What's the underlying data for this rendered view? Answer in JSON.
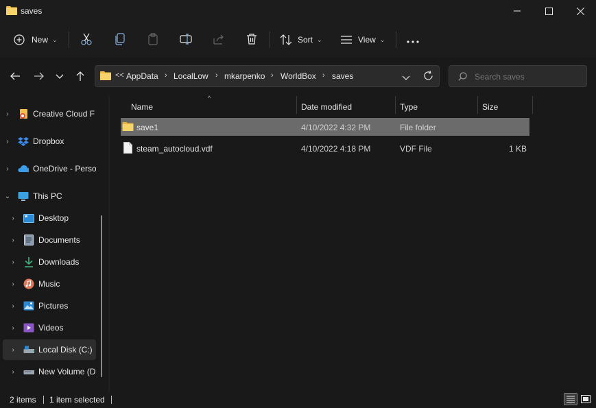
{
  "window": {
    "title": "saves",
    "controls": [
      "minimize",
      "maximize",
      "close"
    ]
  },
  "commandbar": {
    "new_label": "New",
    "sort_label": "Sort",
    "view_label": "View",
    "icons": [
      "cut-icon",
      "copy-icon",
      "paste-icon",
      "rename-icon",
      "share-icon",
      "delete-icon",
      "more-icon"
    ]
  },
  "address": {
    "overflow": "<<",
    "crumbs": [
      "AppData",
      "LocalLow",
      "mkarpenko",
      "WorldBox",
      "saves"
    ],
    "search_placeholder": "Search saves"
  },
  "nav": {
    "items": [
      {
        "label": "Creative Cloud F",
        "icon": "creative-cloud-icon",
        "expanded": false
      },
      {
        "label": "Dropbox",
        "icon": "dropbox-icon",
        "expanded": false
      },
      {
        "label": "OneDrive - Perso",
        "icon": "onedrive-icon",
        "expanded": false
      },
      {
        "label": "This PC",
        "icon": "this-pc-icon",
        "expanded": true
      },
      {
        "label": "Desktop",
        "icon": "desktop-icon"
      },
      {
        "label": "Documents",
        "icon": "documents-icon"
      },
      {
        "label": "Downloads",
        "icon": "downloads-icon"
      },
      {
        "label": "Music",
        "icon": "music-icon"
      },
      {
        "label": "Pictures",
        "icon": "pictures-icon"
      },
      {
        "label": "Videos",
        "icon": "videos-icon"
      },
      {
        "label": "Local Disk (C:)",
        "icon": "local-disk-icon",
        "selected": true
      },
      {
        "label": "New Volume (D",
        "icon": "drive-icon"
      }
    ]
  },
  "columns": {
    "name": "Name",
    "date": "Date modified",
    "type": "Type",
    "size": "Size"
  },
  "files": [
    {
      "name": "save1",
      "date": "4/10/2022 4:32 PM",
      "type": "File folder",
      "size": "",
      "icon": "folder-icon",
      "selected": true
    },
    {
      "name": "steam_autocloud.vdf",
      "date": "4/10/2022 4:18 PM",
      "type": "VDF File",
      "size": "1 KB",
      "icon": "file-icon",
      "selected": false
    }
  ],
  "status": {
    "item_count": "2 items",
    "selection": "1 item selected"
  },
  "colors": {
    "background": "#191919",
    "selected_row": "#6b6b6b",
    "folder": "#f0c04a",
    "accent": "#4aa3f0"
  }
}
